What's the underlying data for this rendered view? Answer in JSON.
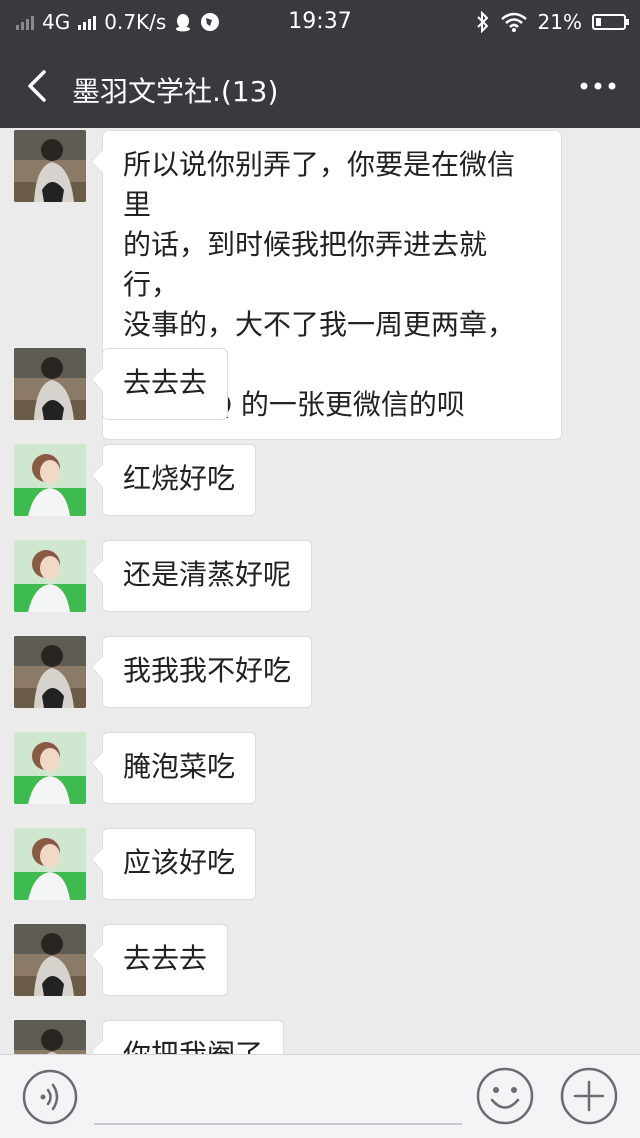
{
  "status_bar": {
    "network": "4G",
    "speed": "0.7K/s",
    "time": "19:37",
    "battery": "21%",
    "battery_level": 0.21
  },
  "header": {
    "title": "墨羽文学社.(13)",
    "back_icon": "chevron-left-icon",
    "more_icon": "more-dots-icon"
  },
  "messages": [
    {
      "avatar": "avatar-a",
      "lines": [
        "所以说你别弄了，你要是在微信里",
        "的话，到时候我把你弄进去就行，",
        "没事的，大不了我一周更两章，一",
        "章更 QQ 的一张更微信的呗"
      ]
    },
    {
      "avatar": "avatar-a",
      "text": "去去去"
    },
    {
      "avatar": "avatar-b",
      "text": "红烧好吃"
    },
    {
      "avatar": "avatar-b",
      "text": "还是清蒸好呢"
    },
    {
      "avatar": "avatar-a",
      "text": "我我我不好吃"
    },
    {
      "avatar": "avatar-b",
      "text": "腌泡菜吃"
    },
    {
      "avatar": "avatar-b",
      "text": "应该好吃"
    },
    {
      "avatar": "avatar-a",
      "text": "去去去"
    },
    {
      "avatar": "avatar-a",
      "text": "你把我阉了"
    }
  ],
  "input_bar": {
    "voice_icon": "voice-icon",
    "emoji_icon": "emoji-icon",
    "plus_icon": "plus-icon",
    "input_value": ""
  },
  "colors": {
    "header_bg": "#393a3f",
    "chat_bg": "#ebebeb",
    "bubble_bg": "#ffffff"
  }
}
